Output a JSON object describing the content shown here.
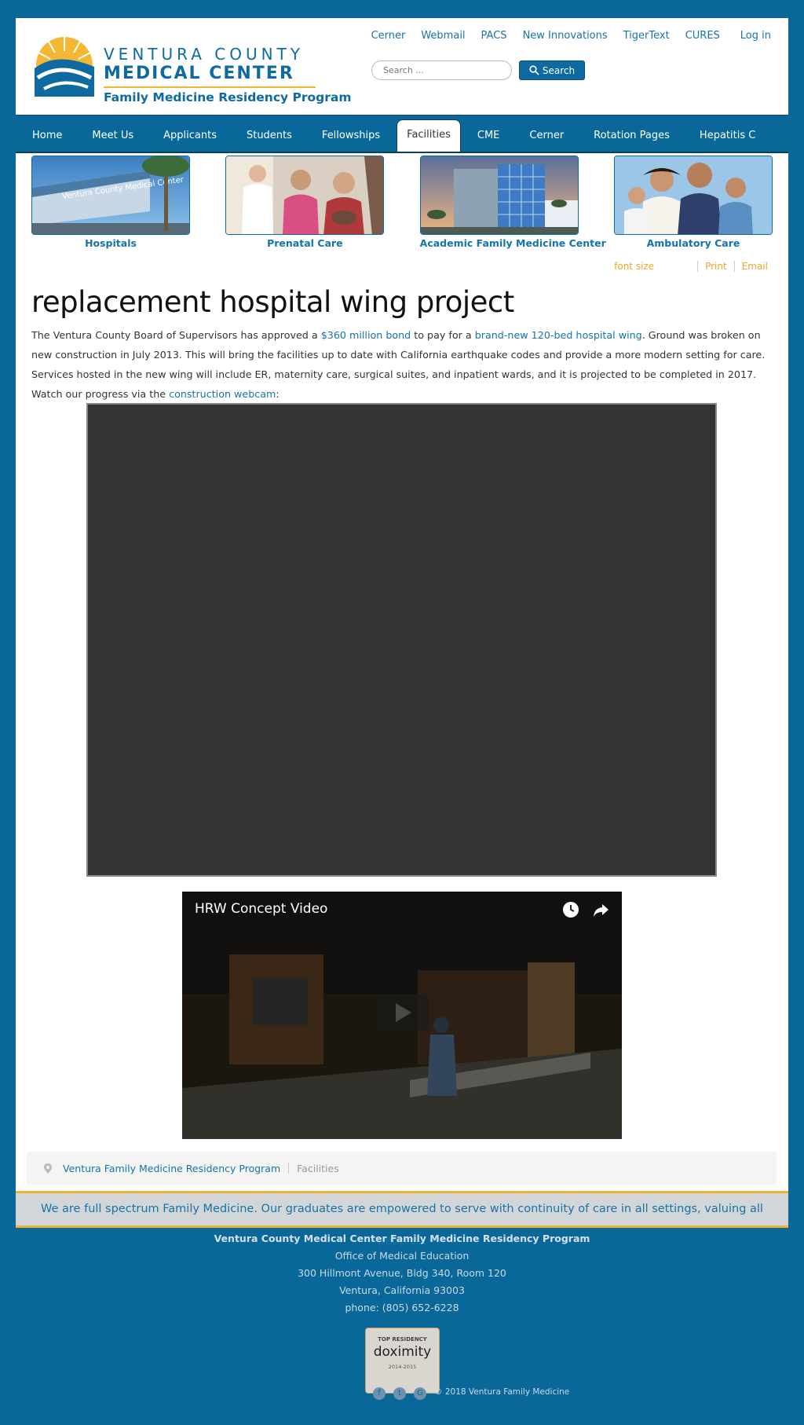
{
  "header": {
    "logo": {
      "line1": "VENTURA COUNTY",
      "line2": "MEDICAL CENTER",
      "line3": "Family Medicine Residency Program"
    },
    "toplinks": [
      "Cerner",
      "Webmail",
      "PACS",
      "New Innovations",
      "TigerText",
      "CURES"
    ],
    "login": "Log in",
    "search": {
      "placeholder": "Search ...",
      "button": "Search"
    }
  },
  "nav": {
    "items": [
      "Home",
      "Meet Us",
      "Applicants",
      "Students",
      "Fellowships",
      "Facilities",
      "CME",
      "Cerner",
      "Rotation Pages",
      "Hepatitis C"
    ],
    "active": "Facilities"
  },
  "facilities": [
    {
      "label": "Hospitals",
      "sign": "Ventura County Medical Center"
    },
    {
      "label": "Prenatal Care"
    },
    {
      "label": "Academic Family Medicine Center"
    },
    {
      "label": "Ambulatory Care"
    }
  ],
  "tools": {
    "font_size": "font size",
    "print": "Print",
    "email": "Email"
  },
  "article": {
    "title": "replacement hospital wing project",
    "p_start": "The Ventura County Board of Supervisors has approved a ",
    "link1": "$360 million bond",
    "p_mid1": " to pay for a ",
    "link2": "brand-new 120-bed hospital wing",
    "p_mid2": ". Ground was broken on new construction in July 2013. This will bring the facilities up to date with California earthquake codes and provide a more modern setting for care. Services hosted in the new wing will include ER, maternity care, surgical suites, and inpatient wards, and it is projected to be completed in 2017. Watch our progress via the ",
    "link3": "construction webcam",
    "p_end": ":"
  },
  "video": {
    "title": "HRW Concept Video"
  },
  "breadcrumb": {
    "home": "Ventura Family Medicine Residency Program",
    "current": "Facilities"
  },
  "mission": "We are full spectrum Family Medicine. Our graduates are empowered to serve with continuity of care in all settings, valuing all peoples.",
  "footer": {
    "org": "Ventura County Medical Center Family Medicine Residency Program",
    "office": "Office of Medical Education",
    "address1": "300 Hillmont Avenue, Bldg 340, Room 120",
    "address2": "Ventura, California 93003",
    "phone": "phone: (805) 652-6228",
    "badge": {
      "top": "TOP RESIDENCY",
      "main": "doximity",
      "years": "2014-2015"
    },
    "copyright": "© 2018 Ventura Family Medicine"
  }
}
